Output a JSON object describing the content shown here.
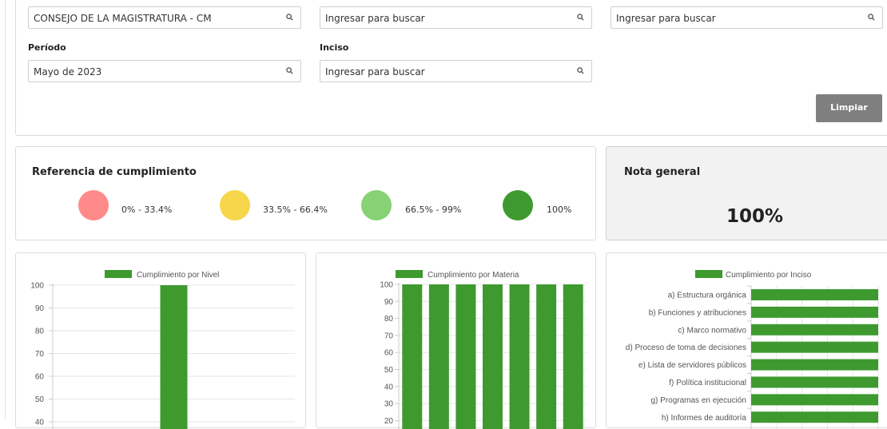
{
  "colors": {
    "bar": "#3e9a2f",
    "grid": "#e6e6e6",
    "ref_low": "#ff8a8a",
    "ref_mid": "#f6d64a",
    "ref_high": "#86d274",
    "ref_full": "#3e9a2f",
    "button": "#7f7f7f"
  },
  "filters": {
    "entity": {
      "value": "CONSEJO DE LA MAGISTRATURA - CM",
      "icon": "search-icon"
    },
    "search2": {
      "placeholder": "Ingresar para buscar",
      "icon": "search-icon"
    },
    "search3": {
      "placeholder": "Ingresar para buscar",
      "icon": "search-icon"
    },
    "period": {
      "label": "Período",
      "value": "Mayo de 2023",
      "icon": "search-icon"
    },
    "inciso": {
      "label": "Inciso",
      "placeholder": "Ingresar para buscar",
      "icon": "search-icon"
    },
    "clear_button": "Limpiar"
  },
  "reference": {
    "title": "Referencia de cumplimiento",
    "items": [
      {
        "range": "0% - 33.4%",
        "color": "#ff8a8a"
      },
      {
        "range": "33.5% - 66.4%",
        "color": "#f6d64a"
      },
      {
        "range": "66.5% - 99%",
        "color": "#86d274"
      },
      {
        "range": "100%",
        "color": "#3e9a2f"
      }
    ]
  },
  "general": {
    "title": "Nota general",
    "value": "100%"
  },
  "chart_data": [
    {
      "type": "bar",
      "legend": "Cumplimiento por Nivel",
      "categories": [
        ""
      ],
      "values": [
        100
      ],
      "y_ticks": [
        "100",
        "90",
        "80",
        "70",
        "60",
        "50",
        "40"
      ],
      "ylim": [
        0,
        100
      ]
    },
    {
      "type": "bar",
      "legend": "Cumplimiento por Materia",
      "categories": [
        "",
        "",
        "",
        "",
        "",
        "",
        ""
      ],
      "values": [
        100,
        100,
        100,
        100,
        100,
        100,
        100
      ],
      "y_ticks": [
        "100",
        "90",
        "80",
        "70",
        "60",
        "50",
        "40",
        "30",
        "20"
      ],
      "ylim": [
        0,
        100
      ]
    },
    {
      "type": "bar",
      "orientation": "horizontal",
      "legend": "Cumplimiento por Inciso",
      "categories": [
        "a) Estructura orgánica",
        "b) Funciones y atribuciones",
        "c) Marco normativo",
        "d) Proceso de toma de decisiones",
        "e) Lista de servidores públicos",
        "f) Política institucional",
        "g) Programas en ejecución",
        "h) Informes de auditoría"
      ],
      "values": [
        100,
        100,
        100,
        100,
        100,
        100,
        100,
        100
      ],
      "xlim": [
        0,
        100
      ]
    }
  ]
}
